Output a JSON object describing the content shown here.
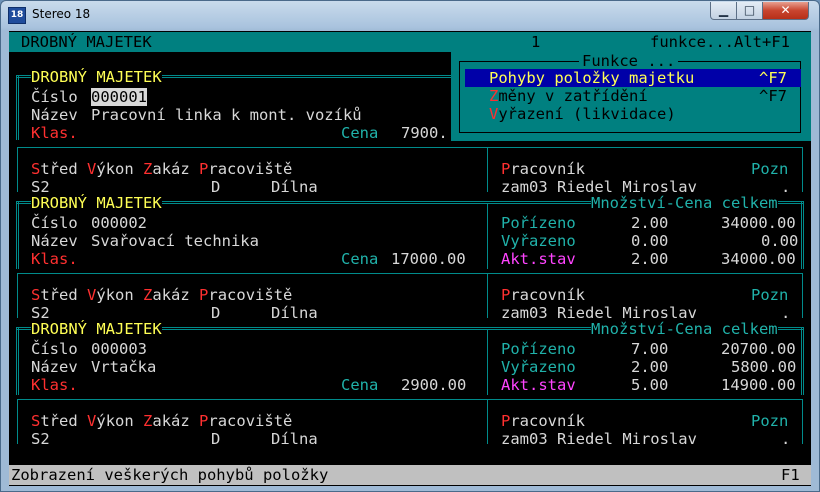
{
  "window": {
    "icon_label": "18",
    "title": "Stereo 18"
  },
  "header": {
    "title": "DROBNÝ MAJETEK",
    "page": "1",
    "hint": "funkce...Alt+F1"
  },
  "menu": {
    "title": "Funkce ...",
    "items": [
      {
        "label": "Pohyby položky majetku",
        "shortcut": "^F7",
        "hot": "P",
        "rest": "ohyby položky majetku"
      },
      {
        "label": "Změny v zatřídění",
        "shortcut": "^F7",
        "hot": "Z",
        "rest": "měny v zatřídění"
      },
      {
        "label": "Vyřazení (likvidace)",
        "shortcut": "",
        "hot": "V",
        "rest": "yřazení (likvidace)"
      }
    ]
  },
  "labels": {
    "section": "DROBNÝ MAJETEK",
    "cislo": "Číslo",
    "nazev": "Název",
    "klas": "Klas.",
    "cena": "Cena",
    "qty_header": "Množství-Cena celkem",
    "porizeno": "Pořízeno",
    "vyrazeno": "Vyřazeno",
    "akt_stav": "Akt.stav",
    "stred_hot": "S",
    "stred_rest": "třed",
    "vykon_hot": "V",
    "vykon_rest": "ýkon",
    "zakaz_hot": "Z",
    "zakaz_rest": "akáz",
    "prac_hot": "P",
    "prac_rest": "racoviště",
    "pracovnik_hot": "P",
    "pracovnik_rest": "racovník",
    "pozn": "Pozn"
  },
  "records": [
    {
      "cislo": "000001",
      "nazev": "Pracovní linka k mont. vozíků",
      "cena": "7900.",
      "stred": "S2",
      "zakaz": "D",
      "pracoviste": "Dílna",
      "pracovnik": "zam03 Riedel Miroslav",
      "pozn": "."
    },
    {
      "cislo": "000002",
      "nazev": "Svařovací technika",
      "cena": "17000.00",
      "porizeno_q": "2.00",
      "porizeno_c": "34000.00",
      "vyrazeno_q": "0.00",
      "vyrazeno_c": "0.00",
      "akt_q": "2.00",
      "akt_c": "34000.00",
      "stred": "S2",
      "zakaz": "D",
      "pracoviste": "Dílna",
      "pracovnik": "zam03 Riedel Miroslav",
      "pozn": "."
    },
    {
      "cislo": "000003",
      "nazev": "Vrtačka",
      "cena": "2900.00",
      "porizeno_q": "7.00",
      "porizeno_c": "20700.00",
      "vyrazeno_q": "2.00",
      "vyrazeno_c": "5800.00",
      "akt_q": "5.00",
      "akt_c": "14900.00",
      "stred": "S2",
      "zakaz": "D",
      "pracoviste": "Dílna",
      "pracovnik": "zam03 Riedel Miroslav",
      "pozn": "."
    }
  ],
  "status": {
    "text": "Zobrazení veškerých pohybů položky",
    "key": "F1"
  }
}
